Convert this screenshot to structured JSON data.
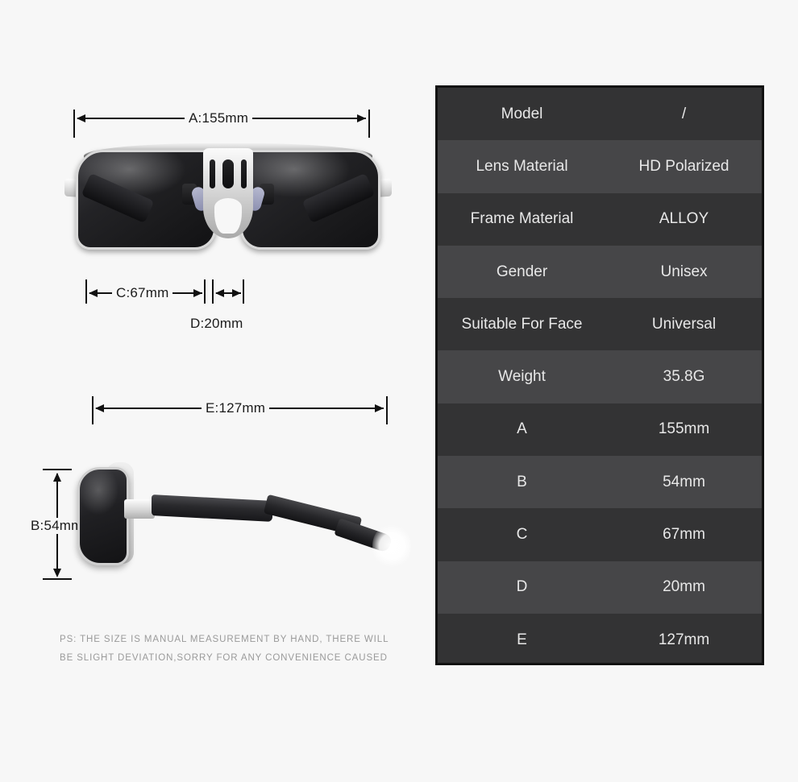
{
  "dimensions": {
    "a": "A:155mm",
    "b": "B:54mm",
    "c": "C:67mm",
    "d": "D:20mm",
    "e": "E:127mm"
  },
  "note": {
    "line1": "PS: THE SIZE IS MANUAL MEASUREMENT BY HAND, THERE WILL",
    "line2": "BE SLIGHT DEVIATION,SORRY FOR ANY CONVENIENCE CAUSED"
  },
  "spec_table": {
    "rows": [
      {
        "key": "Model",
        "value": "/"
      },
      {
        "key": "Lens Material",
        "value": "HD Polarized"
      },
      {
        "key": "Frame Material",
        "value": "ALLOY"
      },
      {
        "key": "Gender",
        "value": "Unisex"
      },
      {
        "key": "Suitable For Face",
        "value": "Universal"
      },
      {
        "key": "Weight",
        "value": "35.8G"
      },
      {
        "key": "A",
        "value": "155mm"
      },
      {
        "key": "B",
        "value": "54mm"
      },
      {
        "key": "C",
        "value": "67mm"
      },
      {
        "key": "D",
        "value": "20mm"
      },
      {
        "key": "E",
        "value": "127mm"
      }
    ]
  },
  "colors": {
    "background": "#f7f7f7",
    "table_border": "#121212",
    "row_dark": "#333334",
    "row_light": "#464648",
    "text_light": "#e8e8e8",
    "dimension_line": "#111111",
    "note_text": "#9a9a9a"
  }
}
